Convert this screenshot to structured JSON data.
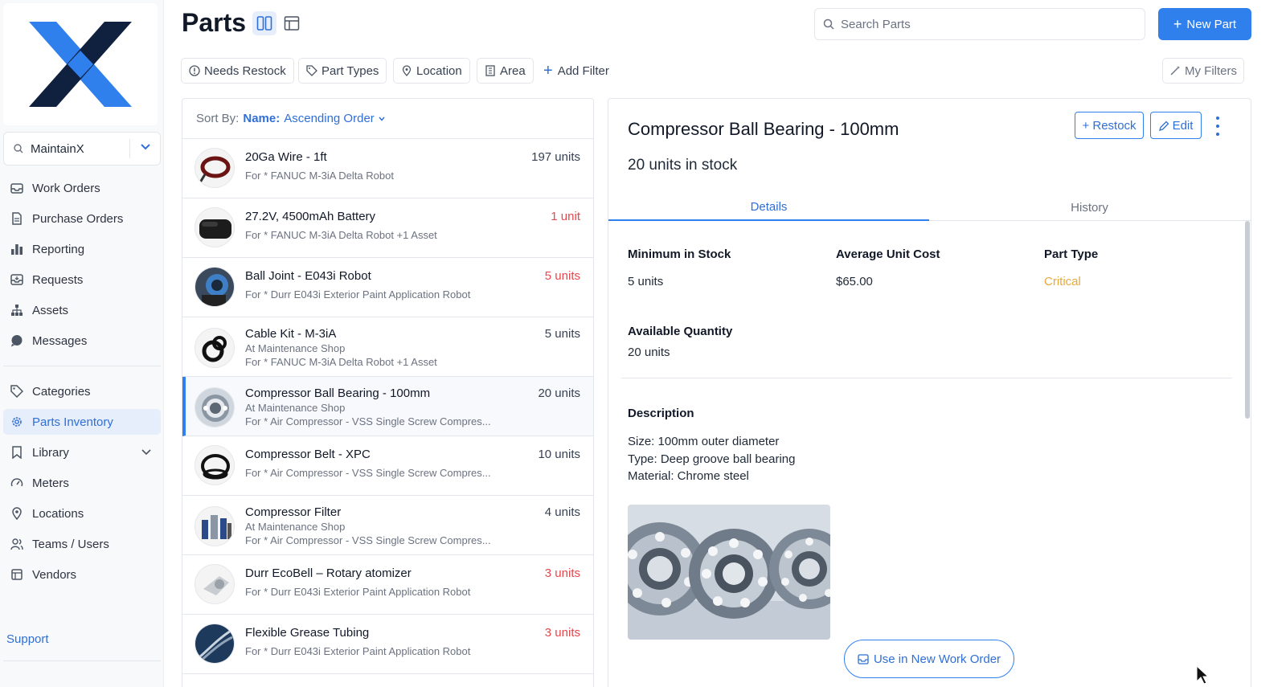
{
  "app": {
    "brand_colors": {
      "navy": "#10203f",
      "blue": "#2f80ed"
    }
  },
  "sidebar": {
    "org_name": "MaintainX",
    "items": [
      {
        "label": "Work Orders",
        "icon": "work-orders-icon"
      },
      {
        "label": "Purchase Orders",
        "icon": "purchase-orders-icon"
      },
      {
        "label": "Reporting",
        "icon": "bar-chart-icon"
      },
      {
        "label": "Requests",
        "icon": "inbox-icon"
      },
      {
        "label": "Assets",
        "icon": "hierarchy-icon"
      },
      {
        "label": "Messages",
        "icon": "chat-icon"
      },
      {
        "label": "Categories",
        "icon": "tag-icon"
      },
      {
        "label": "Parts Inventory",
        "icon": "gear-icon",
        "active": true
      },
      {
        "label": "Library",
        "icon": "bookmark-icon"
      },
      {
        "label": "Meters",
        "icon": "gauge-icon"
      },
      {
        "label": "Locations",
        "icon": "map-pin-icon"
      },
      {
        "label": "Teams / Users",
        "icon": "users-icon"
      },
      {
        "label": "Vendors",
        "icon": "vendors-icon"
      }
    ],
    "support_label": "Support"
  },
  "header": {
    "title": "Parts",
    "search_placeholder": "Search Parts",
    "new_part_label": "New Part"
  },
  "filters": {
    "chips": [
      "Needs Restock",
      "Part Types",
      "Location",
      "Area"
    ],
    "add_filter_label": "Add Filter",
    "my_filters_label": "My Filters"
  },
  "list": {
    "sort_prefix": "Sort By:",
    "sort_key": "Name:",
    "sort_value": "Ascending Order",
    "parts": [
      {
        "name": "20Ga Wire - 1ft",
        "lines": [
          "For * FANUC M-3iA Delta Robot"
        ],
        "qty": "197 units",
        "low": false
      },
      {
        "name": "27.2V, 4500mAh Battery",
        "lines": [
          "For * FANUC M-3iA Delta Robot +1 Asset"
        ],
        "qty": "1 unit",
        "low": true
      },
      {
        "name": "Ball Joint - E043i Robot",
        "lines": [
          "For * Durr E043i Exterior Paint Application Robot"
        ],
        "qty": "5 units",
        "low": true
      },
      {
        "name": "Cable Kit - M-3iA",
        "lines": [
          "At Maintenance Shop",
          "For * FANUC M-3iA Delta Robot +1 Asset"
        ],
        "qty": "5 units",
        "low": false
      },
      {
        "name": "Compressor Ball Bearing - 100mm",
        "lines": [
          "At Maintenance Shop",
          "For * Air Compressor - VSS Single Screw Compres..."
        ],
        "qty": "20 units",
        "low": false,
        "selected": true
      },
      {
        "name": "Compressor Belt - XPC",
        "lines": [
          "For * Air Compressor - VSS Single Screw Compres..."
        ],
        "qty": "10 units",
        "low": false
      },
      {
        "name": "Compressor Filter",
        "lines": [
          "At Maintenance Shop",
          "For * Air Compressor - VSS Single Screw Compres..."
        ],
        "qty": "4 units",
        "low": false
      },
      {
        "name": "Durr EcoBell – Rotary atomizer",
        "lines": [
          "For * Durr E043i Exterior Paint Application Robot"
        ],
        "qty": "3 units",
        "low": true
      },
      {
        "name": "Flexible Grease Tubing",
        "lines": [
          "For * Durr E043i Exterior Paint Application Robot"
        ],
        "qty": "3 units",
        "low": true
      }
    ]
  },
  "detail": {
    "title": "Compressor Ball Bearing - 100mm",
    "stock": "20 units in stock",
    "restock_label": "+ Restock",
    "edit_label": "Edit",
    "tabs": [
      "Details",
      "History"
    ],
    "fields": {
      "min_label": "Minimum in Stock",
      "min_value": "5 units",
      "avg_label": "Average Unit Cost",
      "avg_value": "$65.00",
      "type_label": "Part Type",
      "type_value": "Critical",
      "avail_label": "Available Quantity",
      "avail_value": "20 units"
    },
    "description_label": "Description",
    "description_lines": [
      "Size: 100mm outer diameter",
      "Type: Deep groove ball bearing",
      "Material: Chrome steel"
    ],
    "use_button_label": "Use in New Work Order"
  }
}
